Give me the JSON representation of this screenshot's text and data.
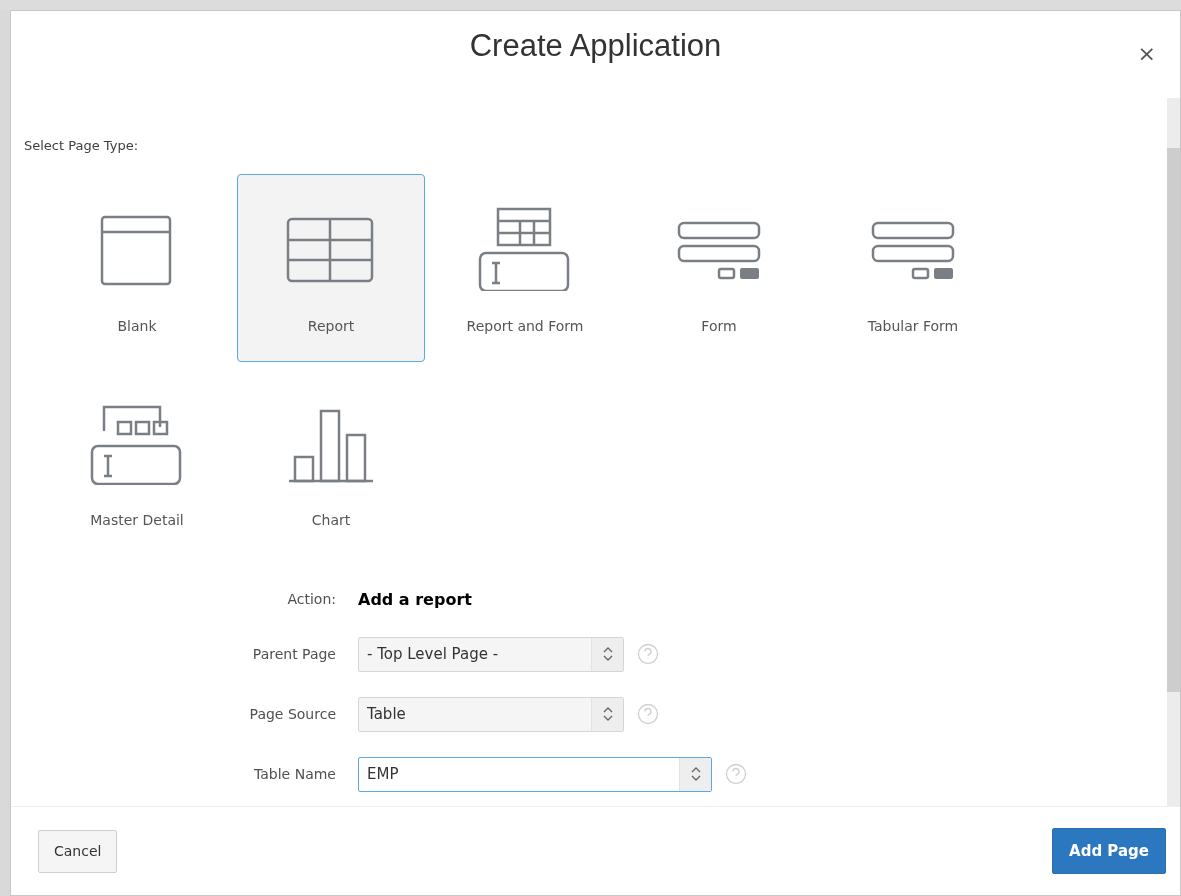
{
  "dialog": {
    "title": "Create Application",
    "close": "×"
  },
  "section_label": "Select Page Type:",
  "page_types": [
    {
      "label": "Blank",
      "kind": "blank",
      "selected": false
    },
    {
      "label": "Report",
      "kind": "report",
      "selected": true
    },
    {
      "label": "Report and Form",
      "kind": "report_form",
      "selected": false
    },
    {
      "label": "Form",
      "kind": "form",
      "selected": false
    },
    {
      "label": "Tabular Form",
      "kind": "tabular_form",
      "selected": false
    },
    {
      "label": "Master Detail",
      "kind": "master_detail",
      "selected": false
    },
    {
      "label": "Chart",
      "kind": "chart",
      "selected": false
    }
  ],
  "action": {
    "label": "Action:",
    "value": "Add a report"
  },
  "fields": [
    {
      "label": "Parent Page",
      "value": "- Top Level Page -",
      "kind": "select",
      "focused": false
    },
    {
      "label": "Page Source",
      "value": "Table",
      "kind": "select",
      "focused": false
    },
    {
      "label": "Table Name",
      "value": "EMP",
      "kind": "combo",
      "focused": true
    }
  ],
  "buttons": [
    {
      "label": "Cancel",
      "kind": "secondary"
    },
    {
      "label": "Add Page",
      "kind": "primary"
    }
  ]
}
